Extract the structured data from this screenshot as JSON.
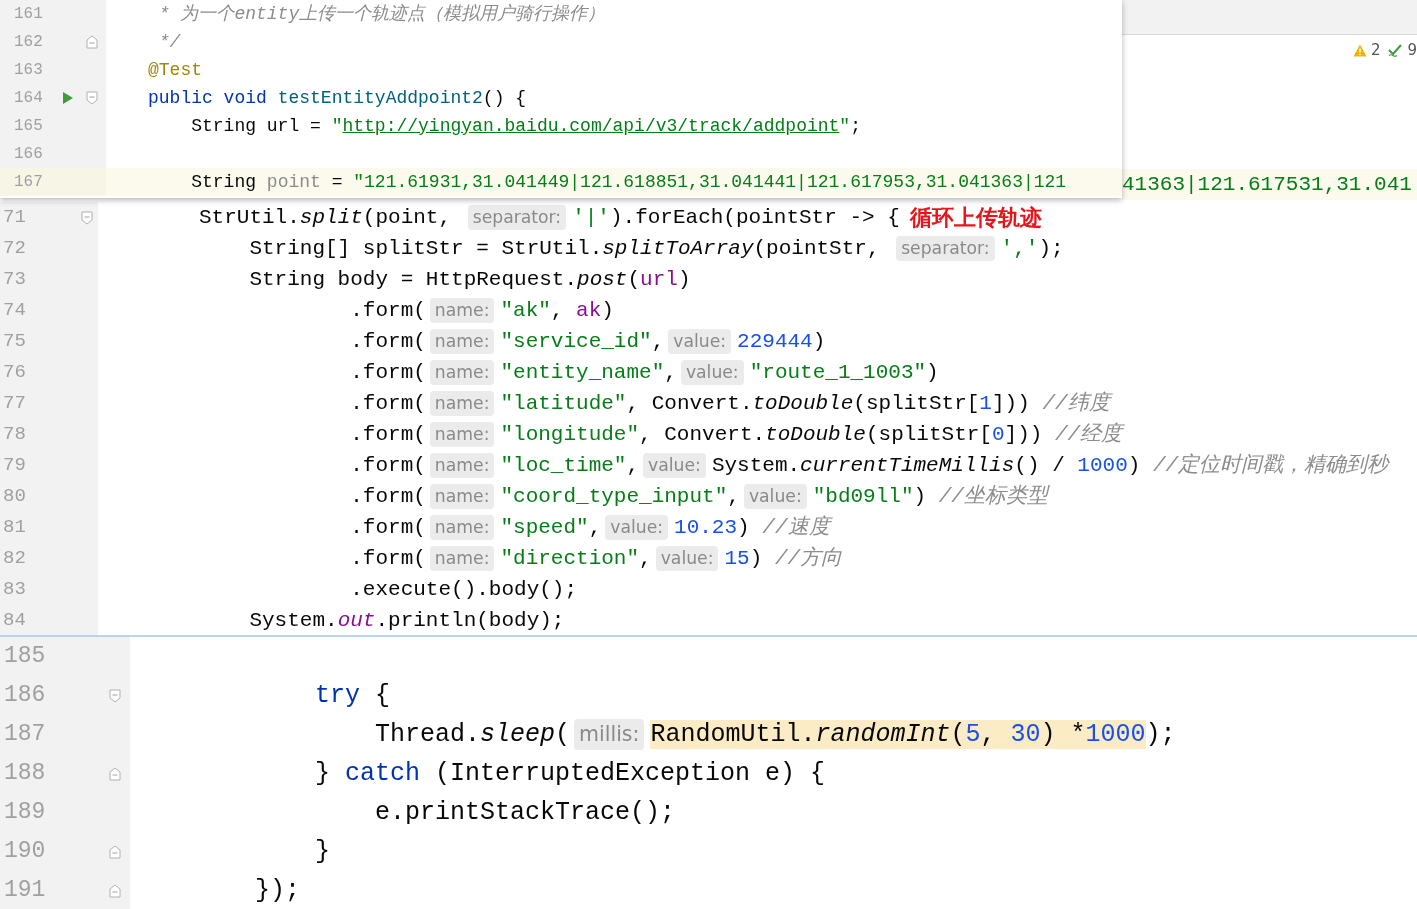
{
  "background_editor": {
    "warnings": "2",
    "checks": "9",
    "line_text": "41363|121.617531,31.041"
  },
  "panels": [
    {
      "lines": [
        {
          "number": "161",
          "parts": [
            {
              "kind": "code",
              "tokens": [
                {
                  "text": " * 为一个entity上传一个轨迹点（模拟用户骑行操作）",
                  "kind": "comment"
                }
              ]
            }
          ]
        },
        {
          "number": "162",
          "fold_end": true,
          "parts": [
            {
              "kind": "code",
              "tokens": [
                {
                  "text": " */",
                  "kind": "comment"
                }
              ]
            }
          ]
        },
        {
          "number": "163",
          "parts": [
            {
              "kind": "code",
              "tokens": [
                {
                  "text": "@Test",
                  "kind": "annotation"
                }
              ]
            }
          ]
        },
        {
          "number": "164",
          "run": true,
          "fold_start": true,
          "parts": [
            {
              "kind": "code",
              "tokens": [
                {
                  "text": "public void ",
                  "kind": "keyword"
                },
                {
                  "text": "testEntityAddpoint2",
                  "kind": "method"
                },
                {
                  "text": "() {",
                  "kind": "plain"
                }
              ]
            }
          ]
        },
        {
          "number": "165",
          "parts": [
            {
              "kind": "code",
              "tokens": [
                {
                  "text": "    String url = ",
                  "kind": "plain"
                },
                {
                  "text": "\"",
                  "kind": "string"
                },
                {
                  "text": "http://yingyan.baidu.com/api/v3/track/addpoint",
                  "kind": "link"
                },
                {
                  "text": "\"",
                  "kind": "string"
                },
                {
                  "text": ";",
                  "kind": "plain"
                }
              ]
            }
          ]
        },
        {
          "number": "166"
        },
        {
          "number": "167",
          "current": true,
          "parts": [
            {
              "kind": "code",
              "tokens": [
                {
                  "text": "    String ",
                  "kind": "plain"
                },
                {
                  "text": "point",
                  "kind": "unused"
                },
                {
                  "text": " = ",
                  "kind": "plain"
                },
                {
                  "text": "\"121.61931,31.041449|121.618851,31.041441|121.617953,31.041363|121",
                  "kind": "string"
                }
              ]
            }
          ]
        }
      ]
    },
    {
      "lines": [
        {
          "number": "71",
          "fold_start": true,
          "parts": [
            {
              "kind": "code",
              "tokens": [
                {
                  "text": "StrUtil.",
                  "kind": "plain"
                },
                {
                  "text": "split",
                  "kind": "static"
                },
                {
                  "text": "(point, ",
                  "kind": "plain"
                }
              ]
            },
            {
              "kind": "hint",
              "text": "separator:"
            },
            {
              "kind": "code",
              "tokens": [
                {
                  "text": "'|'",
                  "kind": "string"
                },
                {
                  "text": ").forEach(pointStr -> {",
                  "kind": "plain"
                }
              ]
            },
            {
              "kind": "note",
              "text": "循环上传轨迹"
            }
          ]
        },
        {
          "number": "72",
          "parts": [
            {
              "kind": "code",
              "tokens": [
                {
                  "text": "    String[] splitStr = StrUtil.",
                  "kind": "plain"
                },
                {
                  "text": "splitToArray",
                  "kind": "static"
                },
                {
                  "text": "(pointStr, ",
                  "kind": "plain"
                }
              ]
            },
            {
              "kind": "hint",
              "text": "separator:"
            },
            {
              "kind": "code",
              "tokens": [
                {
                  "text": "','",
                  "kind": "string"
                },
                {
                  "text": ");",
                  "kind": "plain"
                }
              ]
            }
          ]
        },
        {
          "number": "73",
          "parts": [
            {
              "kind": "code",
              "tokens": [
                {
                  "text": "    String body = HttpRequest.",
                  "kind": "plain"
                },
                {
                  "text": "post",
                  "kind": "static"
                },
                {
                  "text": "(",
                  "kind": "plain"
                },
                {
                  "text": "url",
                  "kind": "field"
                },
                {
                  "text": ")",
                  "kind": "plain"
                }
              ]
            }
          ]
        },
        {
          "number": "74",
          "parts": [
            {
              "kind": "code",
              "tokens": [
                {
                  "text": "            .form(",
                  "kind": "plain"
                }
              ]
            },
            {
              "kind": "hint",
              "text": "name:"
            },
            {
              "kind": "code",
              "tokens": [
                {
                  "text": "\"ak\"",
                  "kind": "string"
                },
                {
                  "text": ", ",
                  "kind": "plain"
                },
                {
                  "text": "ak",
                  "kind": "field"
                },
                {
                  "text": ")",
                  "kind": "plain"
                }
              ]
            }
          ]
        },
        {
          "number": "75",
          "parts": [
            {
              "kind": "code",
              "tokens": [
                {
                  "text": "            .form(",
                  "kind": "plain"
                }
              ]
            },
            {
              "kind": "hint",
              "text": "name:"
            },
            {
              "kind": "code",
              "tokens": [
                {
                  "text": "\"service_id\"",
                  "kind": "string"
                },
                {
                  "text": ",",
                  "kind": "plain"
                }
              ]
            },
            {
              "kind": "hint",
              "text": "value:"
            },
            {
              "kind": "code",
              "tokens": [
                {
                  "text": "229444",
                  "kind": "number"
                },
                {
                  "text": ")",
                  "kind": "plain"
                }
              ]
            }
          ]
        },
        {
          "number": "76",
          "parts": [
            {
              "kind": "code",
              "tokens": [
                {
                  "text": "            .form(",
                  "kind": "plain"
                }
              ]
            },
            {
              "kind": "hint",
              "text": "name:"
            },
            {
              "kind": "code",
              "tokens": [
                {
                  "text": "\"entity_name\"",
                  "kind": "string"
                },
                {
                  "text": ",",
                  "kind": "plain"
                }
              ]
            },
            {
              "kind": "hint",
              "text": "value:"
            },
            {
              "kind": "code",
              "tokens": [
                {
                  "text": "\"route_1_1003\"",
                  "kind": "string"
                },
                {
                  "text": ")",
                  "kind": "plain"
                }
              ]
            }
          ]
        },
        {
          "number": "77",
          "parts": [
            {
              "kind": "code",
              "tokens": [
                {
                  "text": "            .form(",
                  "kind": "plain"
                }
              ]
            },
            {
              "kind": "hint",
              "text": "name:"
            },
            {
              "kind": "code",
              "tokens": [
                {
                  "text": "\"latitude\"",
                  "kind": "string"
                },
                {
                  "text": ", Convert.",
                  "kind": "plain"
                },
                {
                  "text": "toDouble",
                  "kind": "static"
                },
                {
                  "text": "(splitStr[",
                  "kind": "plain"
                },
                {
                  "text": "1",
                  "kind": "number"
                },
                {
                  "text": "])) ",
                  "kind": "plain"
                },
                {
                  "text": "//纬度",
                  "kind": "comment"
                }
              ]
            }
          ]
        },
        {
          "number": "78",
          "parts": [
            {
              "kind": "code",
              "tokens": [
                {
                  "text": "            .form(",
                  "kind": "plain"
                }
              ]
            },
            {
              "kind": "hint",
              "text": "name:"
            },
            {
              "kind": "code",
              "tokens": [
                {
                  "text": "\"longitude\"",
                  "kind": "string"
                },
                {
                  "text": ", Convert.",
                  "kind": "plain"
                },
                {
                  "text": "toDouble",
                  "kind": "static"
                },
                {
                  "text": "(splitStr[",
                  "kind": "plain"
                },
                {
                  "text": "0",
                  "kind": "number"
                },
                {
                  "text": "])) ",
                  "kind": "plain"
                },
                {
                  "text": "//经度",
                  "kind": "comment"
                }
              ]
            }
          ]
        },
        {
          "number": "79",
          "parts": [
            {
              "kind": "code",
              "tokens": [
                {
                  "text": "            .form(",
                  "kind": "plain"
                }
              ]
            },
            {
              "kind": "hint",
              "text": "name:"
            },
            {
              "kind": "code",
              "tokens": [
                {
                  "text": "\"loc_time\"",
                  "kind": "string"
                },
                {
                  "text": ",",
                  "kind": "plain"
                }
              ]
            },
            {
              "kind": "hint",
              "text": "value:"
            },
            {
              "kind": "code",
              "tokens": [
                {
                  "text": "System.",
                  "kind": "plain"
                },
                {
                  "text": "currentTimeMillis",
                  "kind": "static"
                },
                {
                  "text": "() / ",
                  "kind": "plain"
                },
                {
                  "text": "1000",
                  "kind": "number"
                },
                {
                  "text": ") ",
                  "kind": "plain"
                },
                {
                  "text": "//定位时间戳，精确到秒",
                  "kind": "comment"
                }
              ]
            }
          ]
        },
        {
          "number": "80",
          "parts": [
            {
              "kind": "code",
              "tokens": [
                {
                  "text": "            .form(",
                  "kind": "plain"
                }
              ]
            },
            {
              "kind": "hint",
              "text": "name:"
            },
            {
              "kind": "code",
              "tokens": [
                {
                  "text": "\"coord_type_input\"",
                  "kind": "string"
                },
                {
                  "text": ",",
                  "kind": "plain"
                }
              ]
            },
            {
              "kind": "hint",
              "text": "value:"
            },
            {
              "kind": "code",
              "tokens": [
                {
                  "text": "\"bd09ll\"",
                  "kind": "string"
                },
                {
                  "text": ") ",
                  "kind": "plain"
                },
                {
                  "text": "//坐标类型",
                  "kind": "comment"
                }
              ]
            }
          ]
        },
        {
          "number": "81",
          "parts": [
            {
              "kind": "code",
              "tokens": [
                {
                  "text": "            .form(",
                  "kind": "plain"
                }
              ]
            },
            {
              "kind": "hint",
              "text": "name:"
            },
            {
              "kind": "code",
              "tokens": [
                {
                  "text": "\"speed\"",
                  "kind": "string"
                },
                {
                  "text": ",",
                  "kind": "plain"
                }
              ]
            },
            {
              "kind": "hint",
              "text": "value:"
            },
            {
              "kind": "code",
              "tokens": [
                {
                  "text": "10.23",
                  "kind": "number"
                },
                {
                  "text": ") ",
                  "kind": "plain"
                },
                {
                  "text": "//速度",
                  "kind": "comment"
                }
              ]
            }
          ]
        },
        {
          "number": "82",
          "parts": [
            {
              "kind": "code",
              "tokens": [
                {
                  "text": "            .form(",
                  "kind": "plain"
                }
              ]
            },
            {
              "kind": "hint",
              "text": "name:"
            },
            {
              "kind": "code",
              "tokens": [
                {
                  "text": "\"direction\"",
                  "kind": "string"
                },
                {
                  "text": ",",
                  "kind": "plain"
                }
              ]
            },
            {
              "kind": "hint",
              "text": "value:"
            },
            {
              "kind": "code",
              "tokens": [
                {
                  "text": "15",
                  "kind": "number"
                },
                {
                  "text": ") ",
                  "kind": "plain"
                },
                {
                  "text": "//方向",
                  "kind": "comment"
                }
              ]
            }
          ]
        },
        {
          "number": "83",
          "parts": [
            {
              "kind": "code",
              "tokens": [
                {
                  "text": "            .execute().body();",
                  "kind": "plain"
                }
              ]
            }
          ]
        },
        {
          "number": "84",
          "parts": [
            {
              "kind": "code",
              "tokens": [
                {
                  "text": "    System.",
                  "kind": "plain"
                },
                {
                  "text": "out",
                  "kind": "static_field"
                },
                {
                  "text": ".println(body);",
                  "kind": "plain"
                }
              ]
            }
          ]
        }
      ]
    },
    {
      "lines": [
        {
          "number": "185"
        },
        {
          "number": "186",
          "fold_start": true,
          "parts": [
            {
              "kind": "code",
              "tokens": [
                {
                  "text": "    try",
                  "kind": "keyword"
                },
                {
                  "text": " {",
                  "kind": "plain"
                }
              ]
            }
          ]
        },
        {
          "number": "187",
          "parts": [
            {
              "kind": "code",
              "tokens": [
                {
                  "text": "        Thread.",
                  "kind": "plain"
                },
                {
                  "text": "sleep",
                  "kind": "static"
                },
                {
                  "text": "(",
                  "kind": "plain"
                }
              ]
            },
            {
              "kind": "hint",
              "text": "millis:"
            },
            {
              "kind": "code",
              "tokens": [
                {
                  "text": "RandomUtil.",
                  "kind": "plain",
                  "highlighted": true
                },
                {
                  "text": "randomInt",
                  "kind": "static",
                  "highlighted": true
                },
                {
                  "text": "(",
                  "kind": "plain",
                  "highlighted": true
                },
                {
                  "text": "5",
                  "kind": "number",
                  "highlighted": true
                },
                {
                  "text": ", ",
                  "kind": "plain",
                  "highlighted": true
                },
                {
                  "text": "30",
                  "kind": "number",
                  "highlighted": true
                },
                {
                  "text": ") *",
                  "kind": "plain",
                  "highlighted": true
                },
                {
                  "text": "1000",
                  "kind": "number",
                  "highlighted": true
                },
                {
                  "text": ");",
                  "kind": "plain"
                }
              ]
            }
          ]
        },
        {
          "number": "188",
          "fold_end": true,
          "parts": [
            {
              "kind": "code",
              "tokens": [
                {
                  "text": "    } ",
                  "kind": "plain"
                },
                {
                  "text": "catch",
                  "kind": "keyword"
                },
                {
                  "text": " (InterruptedException e) {",
                  "kind": "plain"
                }
              ]
            }
          ]
        },
        {
          "number": "189",
          "parts": [
            {
              "kind": "code",
              "tokens": [
                {
                  "text": "        e.printStackTrace();",
                  "kind": "plain"
                }
              ]
            }
          ]
        },
        {
          "number": "190",
          "fold_end": true,
          "parts": [
            {
              "kind": "code",
              "tokens": [
                {
                  "text": "    }",
                  "kind": "plain"
                }
              ]
            }
          ]
        },
        {
          "number": "191",
          "fold_end": true,
          "parts": [
            {
              "kind": "code",
              "tokens": [
                {
                  "text": "});",
                  "kind": "plain"
                }
              ]
            }
          ]
        }
      ]
    }
  ]
}
